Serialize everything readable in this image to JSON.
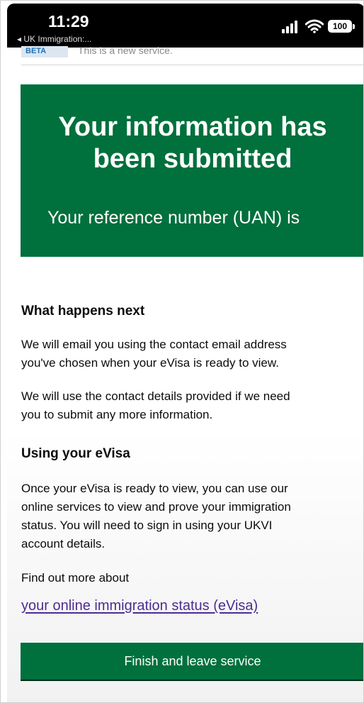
{
  "status_bar": {
    "time": "11:29",
    "back_app": "◂ UK Immigration:...",
    "battery": "100"
  },
  "notice": {
    "tag": "BETA",
    "text": "This is a new service."
  },
  "panel": {
    "title_line1": "Your information has",
    "title_line2": "been submitted",
    "reference_text": "Your reference number (UAN) is"
  },
  "next": {
    "heading": "What happens next",
    "para1_line1": "We will email you using the contact email address",
    "para1_line2": "you've chosen when your eVisa is ready to view.",
    "para2_line1": "We will use the contact details provided if we need",
    "para2_line2": "you to submit any more information."
  },
  "evisa": {
    "heading": "Using your eVisa",
    "para_line1": "Once your eVisa is ready to view, you can use our",
    "para_line2": "online services to view and prove your immigration",
    "para_line3": "status. You will need to sign in using your UKVI",
    "para_line4": "account details.",
    "find_out": "Find out more about",
    "link_text": "your online immigration status (eVisa)"
  },
  "finish_button_label": "Finish and leave service",
  "colors": {
    "panel_green": "#00703c",
    "link_purple": "#4c2c92",
    "text": "#0b0c0c"
  },
  "icons": {
    "signal": "cellular-signal-icon",
    "wifi": "wifi-icon",
    "battery": "battery-icon"
  }
}
